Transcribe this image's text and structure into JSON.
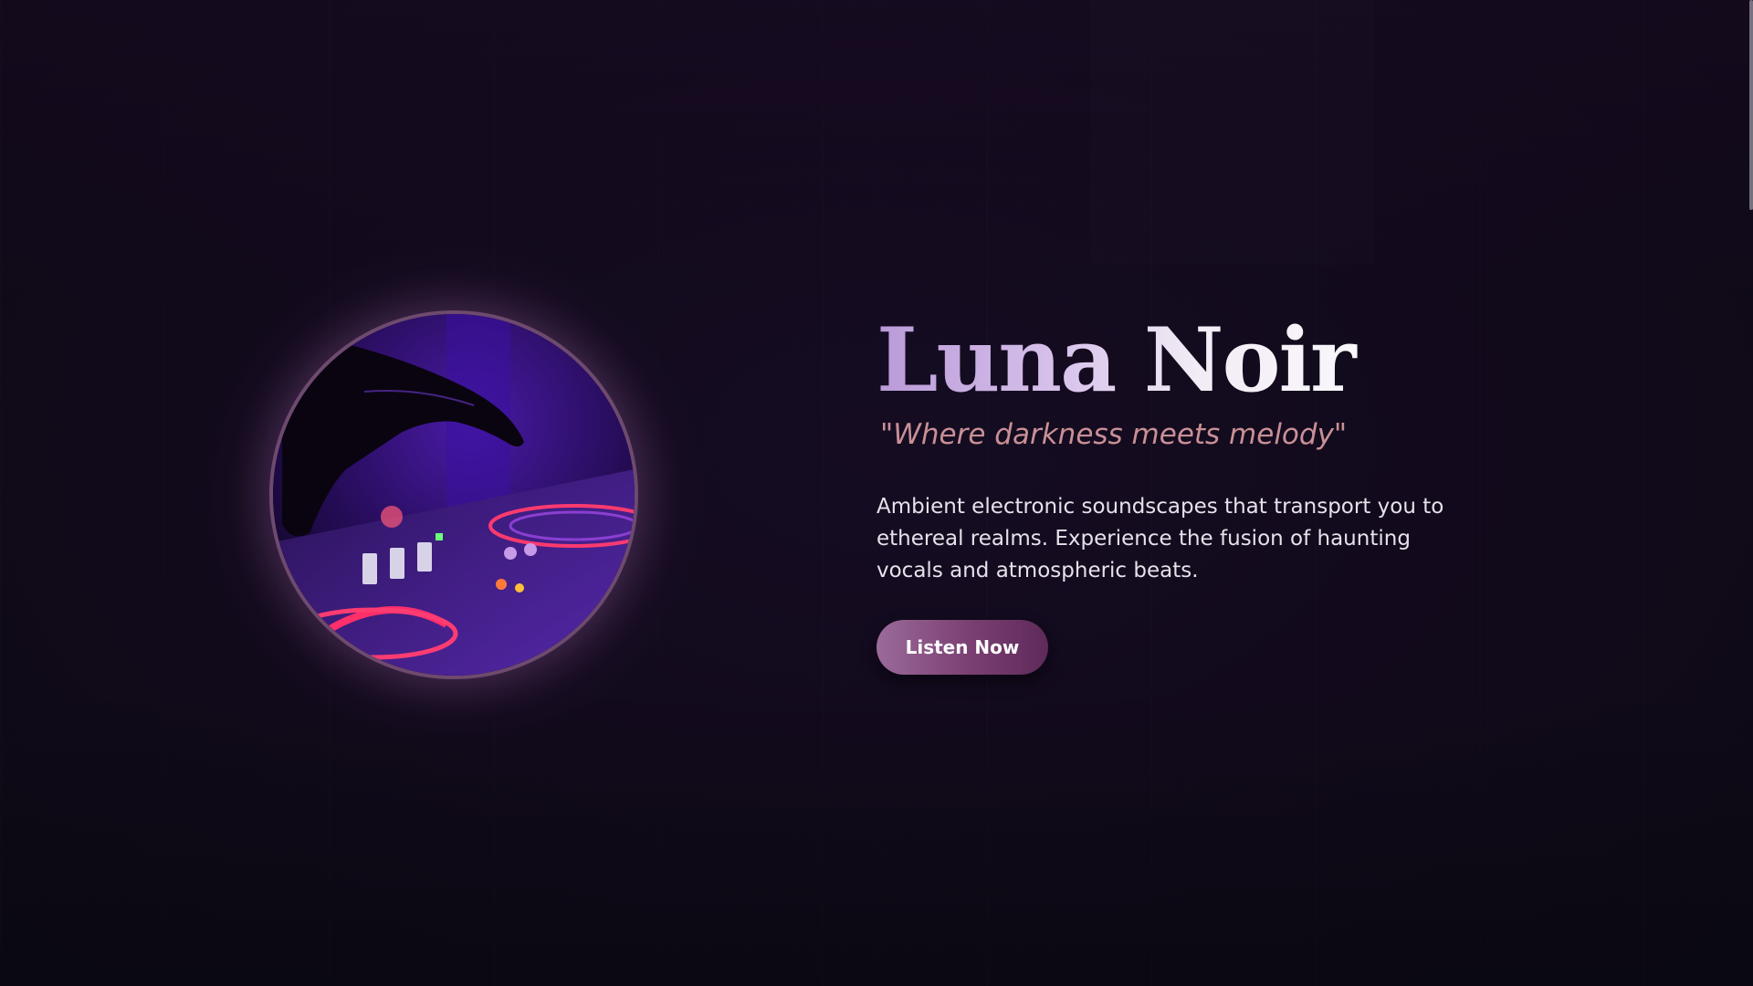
{
  "hero": {
    "title": "Luna Noir",
    "tagline": "\"Where darkness meets melody\"",
    "description": "Ambient electronic soundscapes that transport you to ethereal realms. Experience the fusion of haunting vocals and atmospheric beats.",
    "cta_label": "Listen Now"
  },
  "image": {
    "subject": "dj-mixer-photo"
  },
  "colors": {
    "background": "#120a1c",
    "title_gradient_start": "#b99ad8",
    "tagline": "#c99096",
    "body_text": "#e6e1ea",
    "button_start": "#9b6b9a",
    "button_end": "#5e2a5a",
    "ring": "#6e4a6f"
  }
}
